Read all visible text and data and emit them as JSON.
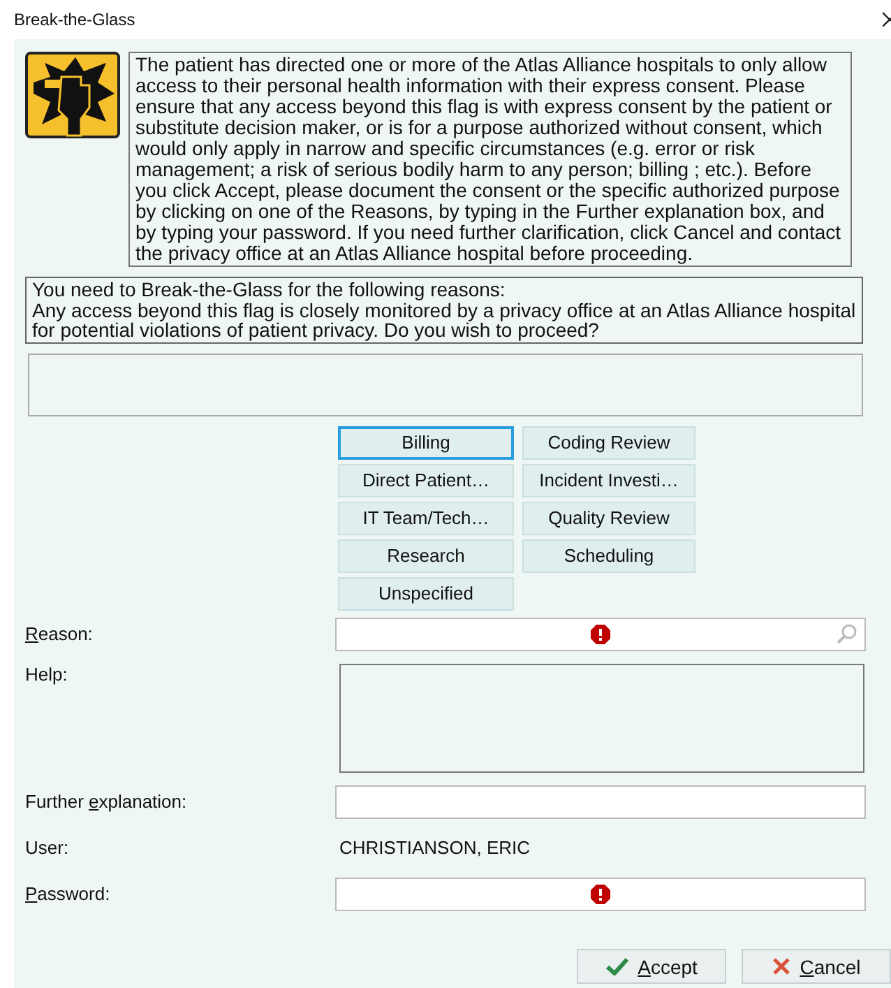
{
  "window": {
    "title": "Break-the-Glass"
  },
  "message": "The patient has directed one or more of the Atlas Alliance hospitals to only allow access to their personal health information with their express consent. Please ensure that any access beyond this flag is with express consent by the patient or substitute decision maker, or is for a purpose authorized without consent, which would only apply in narrow and specific circumstances (e.g. error or risk management; a risk of serious bodily harm to any person; billing ; etc.). Before you click Accept, please document the consent or the specific authorized purpose by clicking on one of the Reasons, by typing in the Further explanation box, and by typing your password. If you need further clarification, click Cancel and contact the privacy office at an Atlas Alliance hospital before proceeding.",
  "reasons_notice": [
    "You need to Break-the-Glass for the following reasons:",
    "Any access beyond this flag is closely monitored by a privacy office at an Atlas Alliance hospital for potential violations of patient privacy. Do you wish to proceed?"
  ],
  "reason_buttons": [
    {
      "label": "Billing",
      "selected": true
    },
    {
      "label": "Coding Review",
      "selected": false
    },
    {
      "label": "Direct Patient…",
      "selected": false
    },
    {
      "label": "Incident Investi…",
      "selected": false
    },
    {
      "label": "IT Team/Tech…",
      "selected": false
    },
    {
      "label": "Quality Review",
      "selected": false
    },
    {
      "label": "Research",
      "selected": false
    },
    {
      "label": "Scheduling",
      "selected": false
    },
    {
      "label": "Unspecified",
      "selected": false
    }
  ],
  "form": [
    {
      "kind": "search",
      "label": [
        {
          "text": "R",
          "underlined": true
        },
        {
          "text": "eason:",
          "underlined": false
        }
      ],
      "required": true
    },
    {
      "kind": "area",
      "label": [
        {
          "text": "Help:",
          "underlined": false
        }
      ]
    },
    {
      "kind": "text",
      "label": [
        {
          "text": "Further ",
          "underlined": false
        },
        {
          "text": "e",
          "underlined": true
        },
        {
          "text": "xplanation:",
          "underlined": false
        }
      ],
      "required": false
    },
    {
      "kind": "value",
      "label": [
        {
          "text": "User:",
          "underlined": false
        }
      ],
      "value": "CHRISTIANSON, ERIC"
    },
    {
      "kind": "password",
      "label": [
        {
          "text": "P",
          "underlined": true
        },
        {
          "text": "assword:",
          "underlined": false
        }
      ],
      "required": true
    }
  ],
  "actions": [
    {
      "kind": "accept",
      "label": [
        {
          "text": "A",
          "underlined": true
        },
        {
          "text": "ccept",
          "underlined": false
        }
      ]
    },
    {
      "kind": "cancel",
      "label": [
        {
          "text": "C",
          "underlined": true
        },
        {
          "text": "ancel",
          "underlined": false
        }
      ]
    }
  ]
}
